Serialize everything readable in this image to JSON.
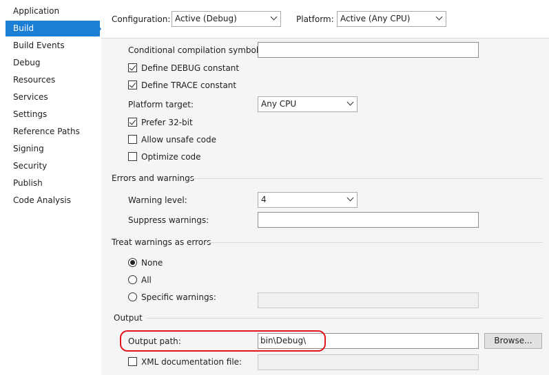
{
  "sidebar": {
    "items": [
      {
        "label": "Application"
      },
      {
        "label": "Build"
      },
      {
        "label": "Build Events"
      },
      {
        "label": "Debug"
      },
      {
        "label": "Resources"
      },
      {
        "label": "Services"
      },
      {
        "label": "Settings"
      },
      {
        "label": "Reference Paths"
      },
      {
        "label": "Signing"
      },
      {
        "label": "Security"
      },
      {
        "label": "Publish"
      },
      {
        "label": "Code Analysis"
      }
    ],
    "selected_index": 1,
    "accent_color": "#1c7fd6"
  },
  "header": {
    "configuration_label": "Configuration:",
    "configuration_value": "Active (Debug)",
    "platform_label": "Platform:",
    "platform_value": "Active (Any CPU)"
  },
  "general": {
    "cond_symbols_label": "Conditional compilation symbols:",
    "cond_symbols_value": "",
    "define_debug_label": "Define DEBUG constant",
    "define_debug_checked": true,
    "define_trace_label": "Define TRACE constant",
    "define_trace_checked": true,
    "platform_target_label": "Platform target:",
    "platform_target_value": "Any CPU",
    "prefer32_label": "Prefer 32-bit",
    "prefer32_checked": true,
    "unsafe_label": "Allow unsafe code",
    "unsafe_checked": false,
    "optimize_label": "Optimize code",
    "optimize_checked": false
  },
  "errors_warnings": {
    "heading": "Errors and warnings",
    "warning_level_label": "Warning level:",
    "warning_level_value": "4",
    "suppress_label": "Suppress warnings:",
    "suppress_value": ""
  },
  "treat_warnings": {
    "heading": "Treat warnings as errors",
    "none_label": "None",
    "all_label": "All",
    "specific_label": "Specific warnings:",
    "selected": "None",
    "specific_value": ""
  },
  "output": {
    "heading": "Output",
    "output_path_label": "Output path:",
    "output_path_value": "bin\\Debug\\",
    "browse_label": "Browse...",
    "xml_doc_label": "XML documentation file:",
    "xml_doc_checked": false,
    "xml_doc_value": "",
    "highlight_color": "#e3131b"
  }
}
